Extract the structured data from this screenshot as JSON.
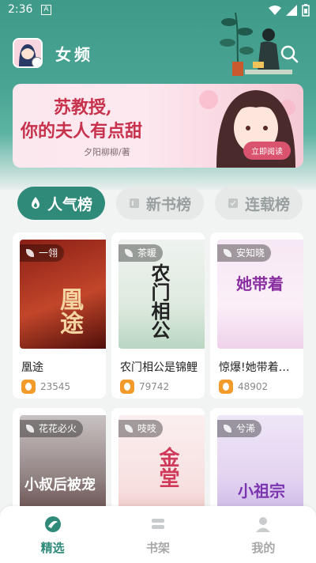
{
  "status": {
    "time": "2:36",
    "notif_letter": "A"
  },
  "header": {
    "channel_title": "女频"
  },
  "banner": {
    "title_line1": "苏教授,",
    "title_line2": "你的夫人有点甜",
    "author": "夕阳柳柳/著",
    "button_label": "立即阅读"
  },
  "tabs": [
    {
      "label": "人气榜",
      "active": true
    },
    {
      "label": "新书榜",
      "active": false
    },
    {
      "label": "连载榜",
      "active": false
    }
  ],
  "books": [
    {
      "title": "凰途",
      "author": "一翎",
      "count": "23545",
      "cover_text": "凰途"
    },
    {
      "title": "农门相公是锦鲤",
      "author": "茶暖",
      "count": "79742",
      "cover_text": "农门相公"
    },
    {
      "title": "惊爆!她带着…",
      "author": "安知晓",
      "count": "48902",
      "cover_text": "她带着"
    },
    {
      "title": "",
      "author": "花花必火",
      "count": "",
      "cover_text": "小叔后被宠"
    },
    {
      "title": "",
      "author": "吱吱",
      "count": "",
      "cover_text": "金堂"
    },
    {
      "title": "",
      "author": "兮浠",
      "count": "",
      "cover_text": "小祖宗"
    }
  ],
  "nav": [
    {
      "label": "精选",
      "icon": "featured-icon",
      "active": true
    },
    {
      "label": "书架",
      "icon": "bookshelf-icon",
      "active": false
    },
    {
      "label": "我的",
      "icon": "profile-icon",
      "active": false
    }
  ],
  "colors": {
    "accent": "#2f8a79",
    "header": "#4aa493",
    "fire": "#f29a2a"
  }
}
